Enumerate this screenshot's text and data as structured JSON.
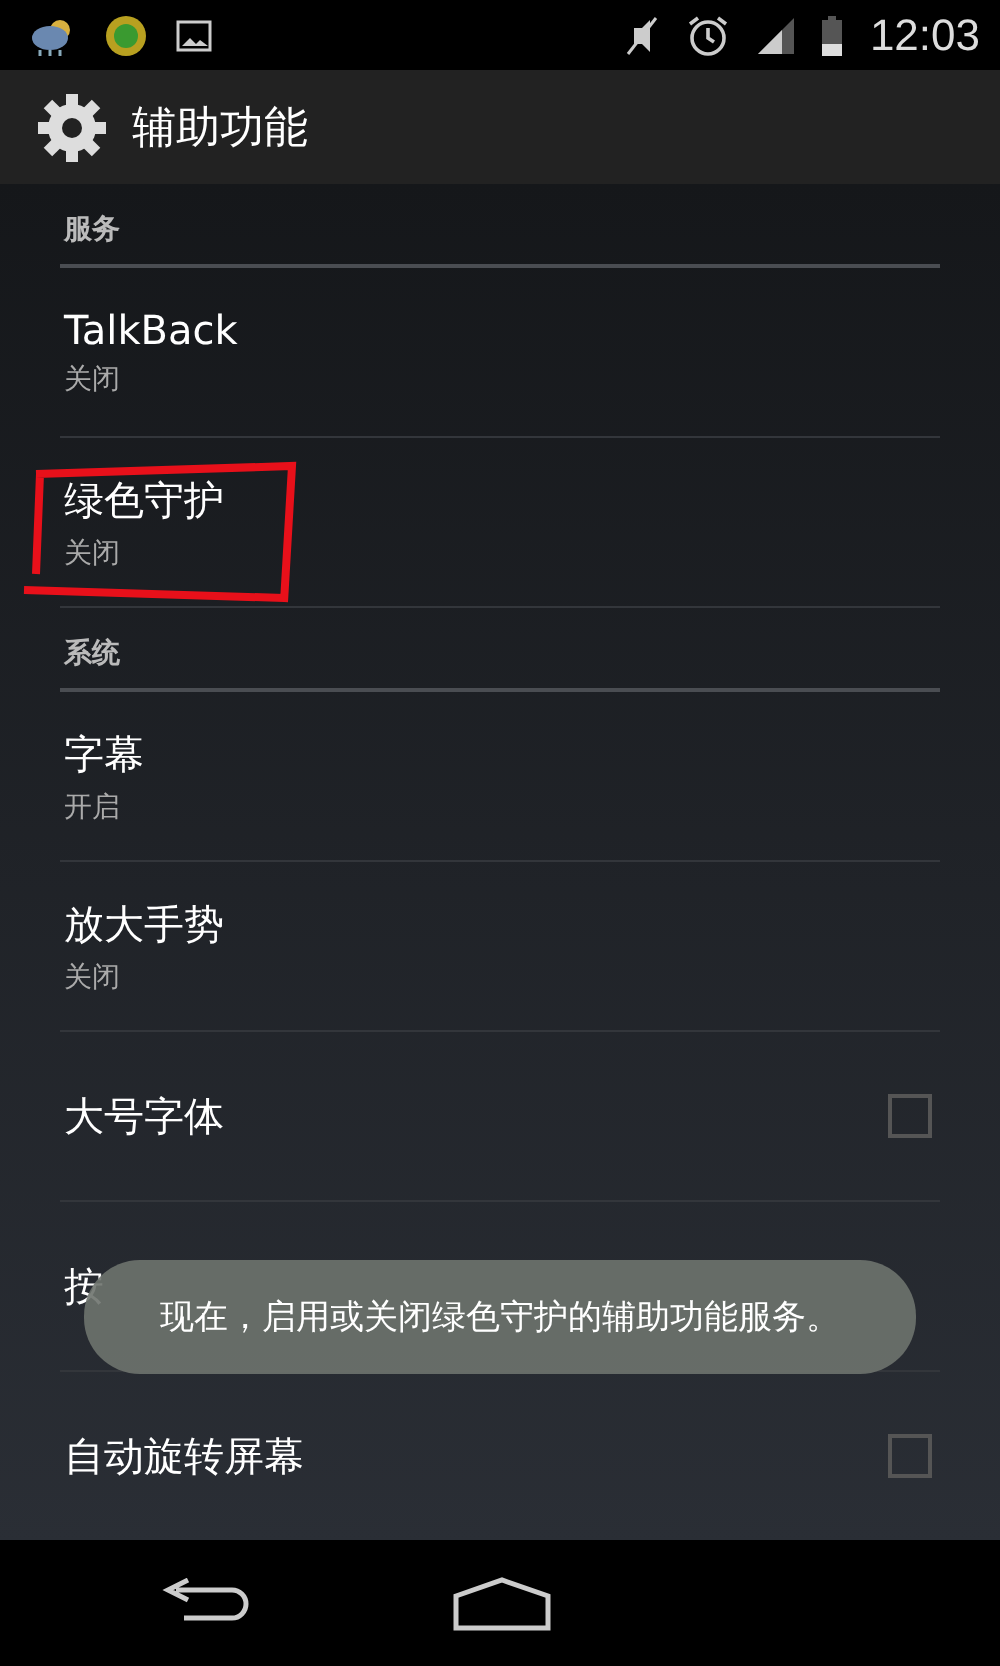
{
  "status_bar": {
    "time": "12:03"
  },
  "action_bar": {
    "title": "辅助功能"
  },
  "sections": [
    {
      "header": "服务",
      "items": [
        {
          "kind": "summary",
          "title": "TalkBack",
          "summary": "关闭",
          "highlighted": false
        },
        {
          "kind": "summary",
          "title": "绿色守护",
          "summary": "关闭",
          "highlighted": true
        }
      ]
    },
    {
      "header": "系统",
      "items": [
        {
          "kind": "summary",
          "title": "字幕",
          "summary": "开启",
          "highlighted": false
        },
        {
          "kind": "summary",
          "title": "放大手势",
          "summary": "关闭",
          "highlighted": false
        },
        {
          "kind": "checkbox",
          "title": "大号字体",
          "checked": false,
          "highlighted": false
        },
        {
          "kind": "plain",
          "title": "按",
          "highlighted": false
        },
        {
          "kind": "checkbox",
          "title": "自动旋转屏幕",
          "checked": false,
          "highlighted": false
        }
      ]
    }
  ],
  "toast": {
    "text": "现在，启用或关闭绿色守护的辅助功能服务。"
  }
}
